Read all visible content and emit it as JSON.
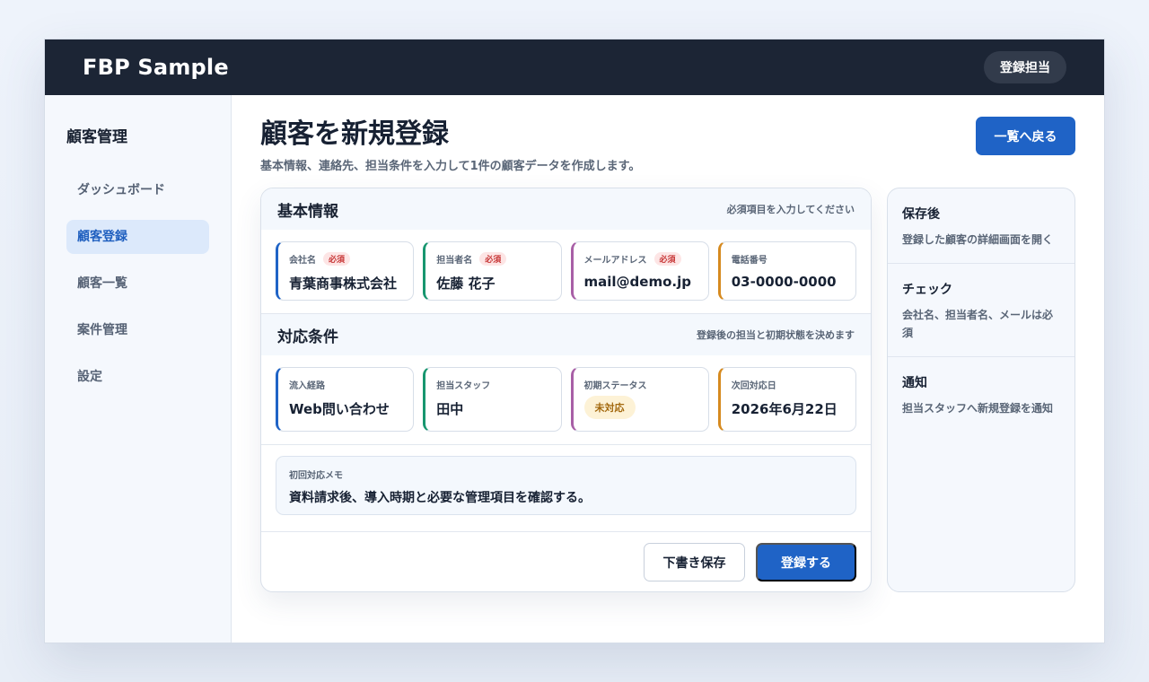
{
  "app": {
    "brand": "FBP Sample",
    "user_role": "登録担当"
  },
  "sidebar": {
    "title": "顧客管理",
    "items": [
      {
        "label": "ダッシュボード",
        "active": false
      },
      {
        "label": "顧客登録",
        "active": true
      },
      {
        "label": "顧客一覧",
        "active": false
      },
      {
        "label": "案件管理",
        "active": false
      },
      {
        "label": "設定",
        "active": false
      }
    ]
  },
  "page": {
    "title": "顧客を新規登録",
    "subtitle": "基本情報、連絡先、担当条件を入力して1件の顧客データを作成します。",
    "back_label": "一覧へ戻る"
  },
  "basic": {
    "title": "基本情報",
    "hint": "必須項目を入力してください",
    "required_label": "必須",
    "company": {
      "label": "会社名",
      "value": "青葉商事株式会社"
    },
    "contact": {
      "label": "担当者名",
      "value": "佐藤 花子"
    },
    "email": {
      "label": "メールアドレス",
      "value": "mail@demo.jp"
    },
    "phone": {
      "label": "電話番号",
      "value": "03-0000-0000"
    }
  },
  "conditions": {
    "title": "対応条件",
    "hint": "登録後の担当と初期状態を決めます",
    "source": {
      "label": "流入経路",
      "value": "Web問い合わせ"
    },
    "staff": {
      "label": "担当スタッフ",
      "value": "田中"
    },
    "status": {
      "label": "初期ステータス",
      "value": "未対応"
    },
    "next_date": {
      "label": "次回対応日",
      "value": "2026年6月22日"
    }
  },
  "memo": {
    "label": "初回対応メモ",
    "value": "資料請求後、導入時期と必要な管理項目を確認する。"
  },
  "actions": {
    "draft_label": "下書き保存",
    "submit_label": "登録する"
  },
  "notes": [
    {
      "title": "保存後",
      "text": "登録した顧客の詳細画面を開く"
    },
    {
      "title": "チェック",
      "text": "会社名、担当者名、メールは必須"
    },
    {
      "title": "通知",
      "text": "担当スタッフへ新規登録を通知"
    }
  ],
  "colors": {
    "accent": "#1f63c6",
    "topbar": "#1c2535",
    "field_blue": "#1f63c6",
    "field_green": "#17966f",
    "field_purple": "#a85fa6",
    "field_orange": "#d68a1f"
  }
}
